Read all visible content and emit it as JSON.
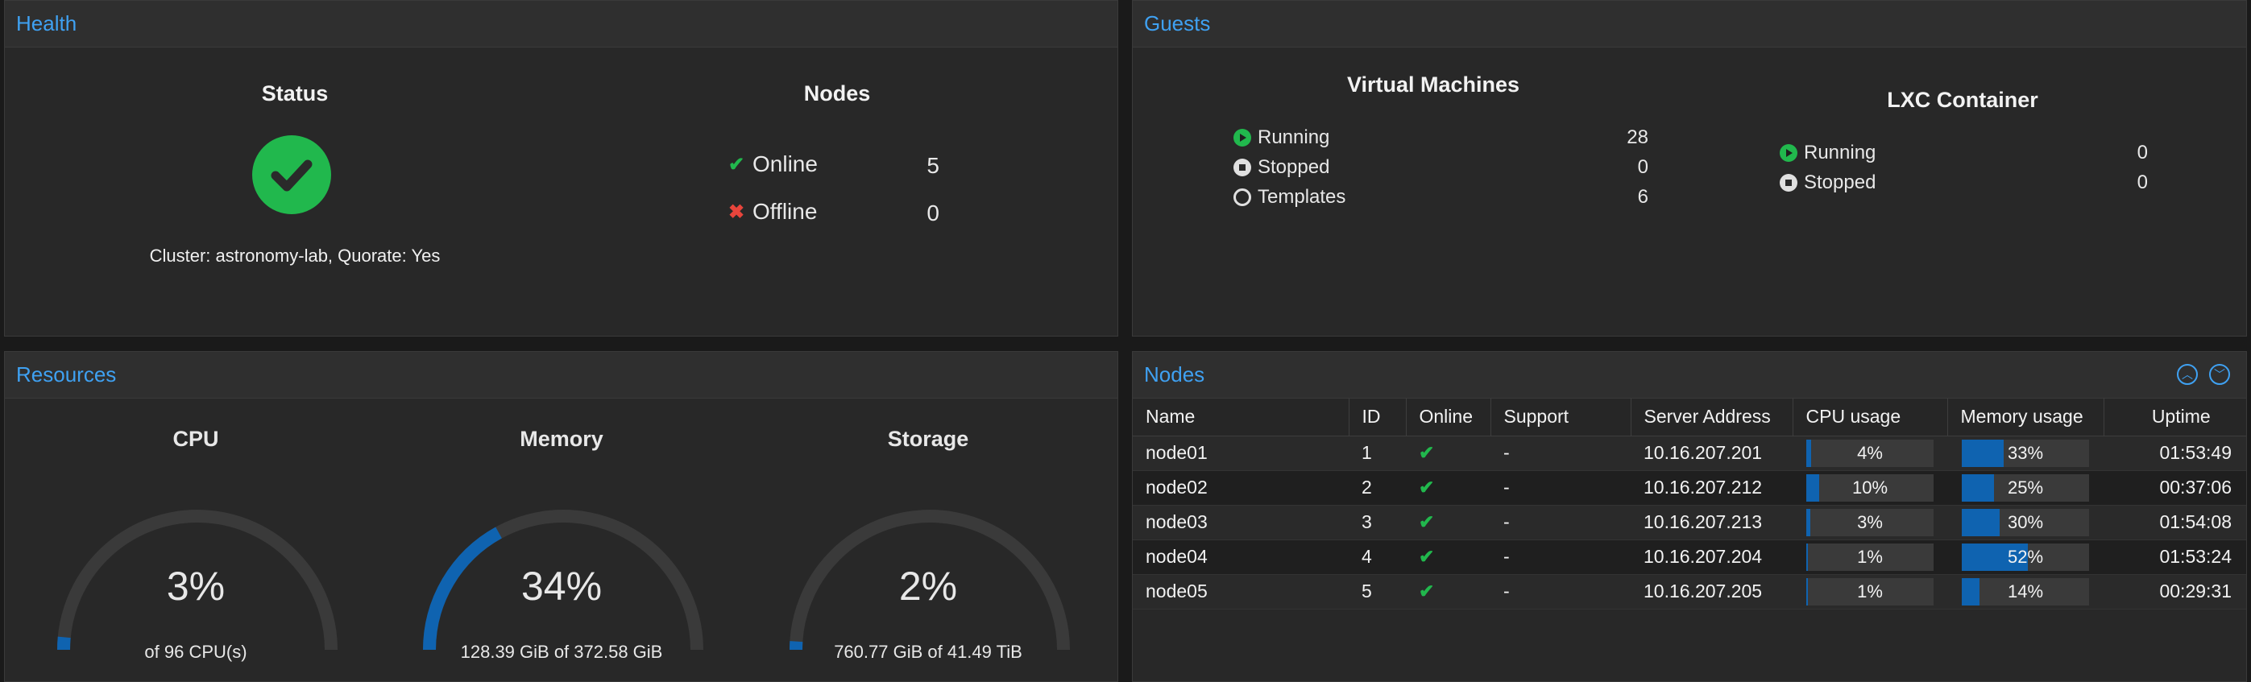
{
  "health": {
    "title": "Health",
    "status_heading": "Status",
    "cluster_text": "Cluster: astronomy-lab, Quorate: Yes",
    "nodes_heading": "Nodes",
    "online_label": "Online",
    "online_count": "5",
    "offline_label": "Offline",
    "offline_count": "0"
  },
  "guests": {
    "title": "Guests",
    "vm_heading": "Virtual Machines",
    "vm_running_label": "Running",
    "vm_running": "28",
    "vm_stopped_label": "Stopped",
    "vm_stopped": "0",
    "vm_templates_label": "Templates",
    "vm_templates": "6",
    "lxc_heading": "LXC Container",
    "lxc_running_label": "Running",
    "lxc_running": "0",
    "lxc_stopped_label": "Stopped",
    "lxc_stopped": "0"
  },
  "resources": {
    "title": "Resources",
    "cpu": {
      "label": "CPU",
      "value": "3%",
      "fraction": 0.03,
      "sub": "of 96 CPU(s)"
    },
    "memory": {
      "label": "Memory",
      "value": "34%",
      "fraction": 0.34,
      "sub": "128.39 GiB of 372.58 GiB"
    },
    "storage": {
      "label": "Storage",
      "value": "2%",
      "fraction": 0.02,
      "sub": "760.77 GiB of 41.49 TiB"
    }
  },
  "nodes_panel": {
    "title": "Nodes",
    "columns": [
      "Name",
      "ID",
      "Online",
      "Support",
      "Server Address",
      "CPU usage",
      "Memory usage",
      "Uptime"
    ],
    "rows": [
      {
        "name": "node01",
        "id": "1",
        "support": "-",
        "address": "10.16.207.201",
        "cpu": "4%",
        "cpu_frac": 0.04,
        "mem": "33%",
        "mem_frac": 0.33,
        "uptime": "01:53:49"
      },
      {
        "name": "node02",
        "id": "2",
        "support": "-",
        "address": "10.16.207.212",
        "cpu": "10%",
        "cpu_frac": 0.1,
        "mem": "25%",
        "mem_frac": 0.25,
        "uptime": "00:37:06"
      },
      {
        "name": "node03",
        "id": "3",
        "support": "-",
        "address": "10.16.207.213",
        "cpu": "3%",
        "cpu_frac": 0.03,
        "mem": "30%",
        "mem_frac": 0.3,
        "uptime": "01:54:08"
      },
      {
        "name": "node04",
        "id": "4",
        "support": "-",
        "address": "10.16.207.204",
        "cpu": "1%",
        "cpu_frac": 0.01,
        "mem": "52%",
        "mem_frac": 0.52,
        "uptime": "01:53:24"
      },
      {
        "name": "node05",
        "id": "5",
        "support": "-",
        "address": "10.16.207.205",
        "cpu": "1%",
        "cpu_frac": 0.01,
        "mem": "14%",
        "mem_frac": 0.14,
        "uptime": "00:29:31"
      }
    ]
  },
  "colors": {
    "accent": "#3fa1f2",
    "ok": "#21b84d",
    "error": "#e8453c",
    "bar": "#0f63b0"
  }
}
